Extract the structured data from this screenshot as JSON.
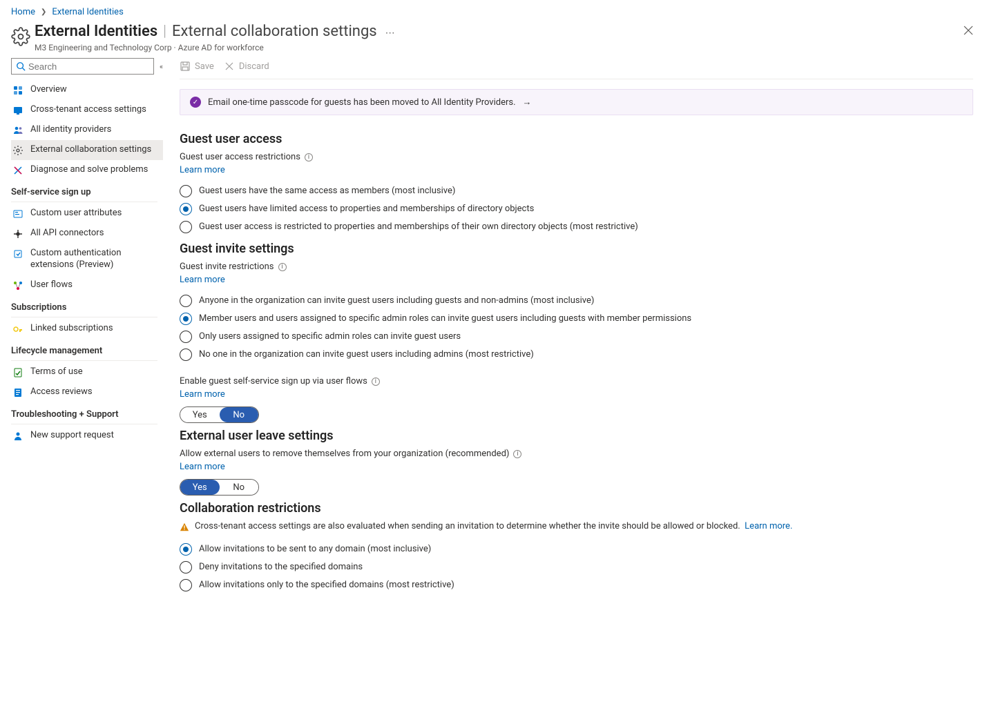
{
  "breadcrumb": {
    "home": "Home",
    "parent": "External Identities"
  },
  "header": {
    "title": "External Identities",
    "subtitle": "External collaboration settings",
    "org": "M3 Engineering and Technology Corp · Azure AD for workforce"
  },
  "sidebar": {
    "search_placeholder": "Search",
    "groups": [
      {
        "header": null,
        "items": [
          {
            "label": "Overview",
            "icon": "overview"
          },
          {
            "label": "Cross-tenant access settings",
            "icon": "xtenant"
          },
          {
            "label": "All identity providers",
            "icon": "idp"
          },
          {
            "label": "External collaboration settings",
            "icon": "gear",
            "active": true
          },
          {
            "label": "Diagnose and solve problems",
            "icon": "diag"
          }
        ]
      },
      {
        "header": "Self-service sign up",
        "items": [
          {
            "label": "Custom user attributes",
            "icon": "attr"
          },
          {
            "label": "All API connectors",
            "icon": "api"
          },
          {
            "label": "Custom authentication extensions (Preview)",
            "icon": "ext"
          },
          {
            "label": "User flows",
            "icon": "flow"
          }
        ]
      },
      {
        "header": "Subscriptions",
        "items": [
          {
            "label": "Linked subscriptions",
            "icon": "key"
          }
        ]
      },
      {
        "header": "Lifecycle management",
        "items": [
          {
            "label": "Terms of use",
            "icon": "tou"
          },
          {
            "label": "Access reviews",
            "icon": "access"
          }
        ]
      },
      {
        "header": "Troubleshooting + Support",
        "items": [
          {
            "label": "New support request",
            "icon": "support"
          }
        ]
      }
    ]
  },
  "cmdbar": {
    "save": "Save",
    "discard": "Discard"
  },
  "banner": {
    "text": "Email one-time passcode for guests has been moved to All Identity Providers."
  },
  "learn_more": "Learn more",
  "guest_access": {
    "heading": "Guest user access",
    "label": "Guest user access restrictions",
    "options": [
      "Guest users have the same access as members (most inclusive)",
      "Guest users have limited access to properties and memberships of directory objects",
      "Guest user access is restricted to properties and memberships of their own directory objects (most restrictive)"
    ],
    "selected": 1
  },
  "guest_invite": {
    "heading": "Guest invite settings",
    "label": "Guest invite restrictions",
    "options": [
      "Anyone in the organization can invite guest users including guests and non-admins (most inclusive)",
      "Member users and users assigned to specific admin roles can invite guest users including guests with member permissions",
      "Only users assigned to specific admin roles can invite guest users",
      "No one in the organization can invite guest users including admins (most restrictive)"
    ],
    "selected": 1,
    "self_service_label": "Enable guest self-service sign up via user flows",
    "toggle": {
      "yes": "Yes",
      "no": "No",
      "value": "No"
    }
  },
  "leave": {
    "heading": "External user leave settings",
    "label": "Allow external users to remove themselves from your organization (recommended)",
    "toggle": {
      "yes": "Yes",
      "no": "No",
      "value": "Yes"
    }
  },
  "collab": {
    "heading": "Collaboration restrictions",
    "warn": "Cross-tenant access settings are also evaluated when sending an invitation to determine whether the invite should be allowed or blocked.",
    "warn_link": "Learn more.",
    "options": [
      "Allow invitations to be sent to any domain (most inclusive)",
      "Deny invitations to the specified domains",
      "Allow invitations only to the specified domains (most restrictive)"
    ],
    "selected": 0
  }
}
